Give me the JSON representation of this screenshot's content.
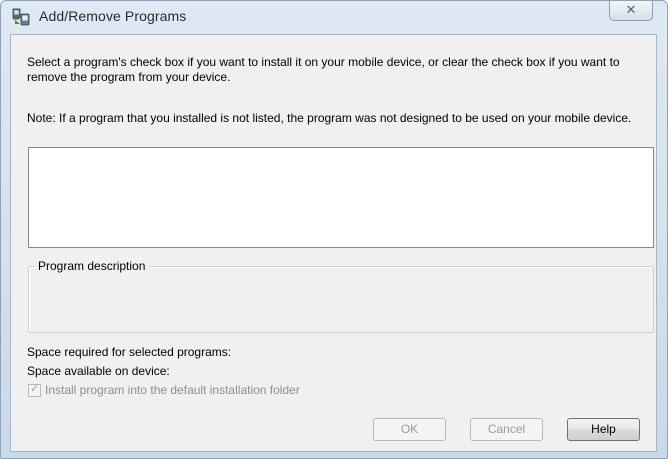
{
  "window": {
    "title": "Add/Remove Programs",
    "close_glyph": "✕",
    "icon": "add-remove-programs-icon"
  },
  "dialog": {
    "intro_text": "Select a program's check box if you want to install it on your mobile device, or clear the check box if you want to remove the program from your device.",
    "note_text": "Note:  If a program that you installed is not listed, the program was not designed to be used on your mobile device.",
    "program_list": {
      "items": []
    },
    "description_group": {
      "legend": "Program description",
      "text": ""
    },
    "space_required_label": "Space required for selected programs:",
    "space_available_label": "Space available on device:",
    "install_default": {
      "label": "Install program into the default installation folder",
      "checked": true,
      "enabled": false
    }
  },
  "buttons": {
    "ok": {
      "label": "OK",
      "enabled": false
    },
    "cancel": {
      "label": "Cancel",
      "enabled": false
    },
    "help": {
      "label": "Help",
      "enabled": true
    }
  },
  "colors": {
    "titlebar": "#cad9e8",
    "client": "#f0f0f0",
    "disabled_text": "#9a9a9a"
  }
}
